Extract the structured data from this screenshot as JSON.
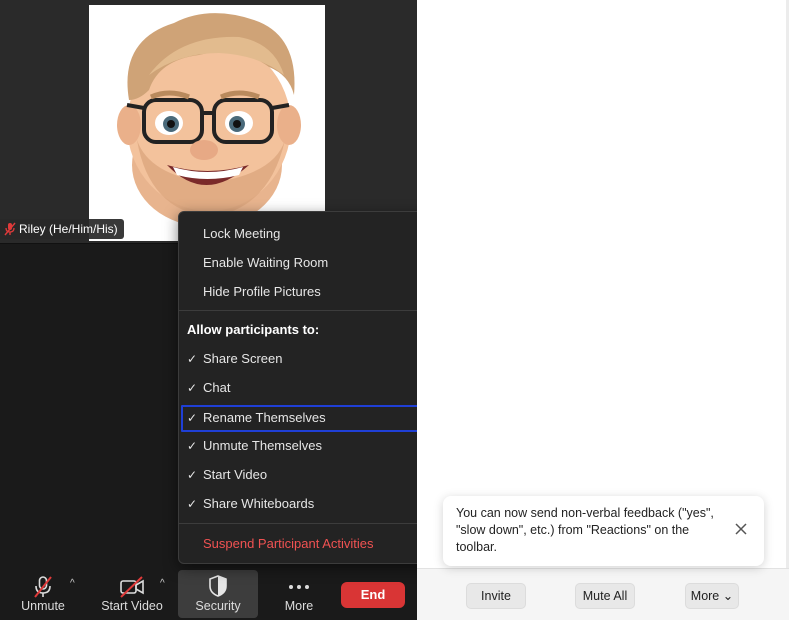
{
  "video": {
    "participant_name": "Riley (He/Him/His)"
  },
  "security_menu": {
    "items_top": [
      {
        "label": "Lock Meeting"
      },
      {
        "label": "Enable Waiting Room"
      },
      {
        "label": "Hide Profile Pictures"
      }
    ],
    "allow_heading": "Allow participants to:",
    "allow_items": [
      {
        "label": "Share Screen",
        "checked": true
      },
      {
        "label": "Chat",
        "checked": true
      },
      {
        "label": "Rename Themselves",
        "checked": true,
        "highlighted": true
      },
      {
        "label": "Unmute Themselves",
        "checked": true
      },
      {
        "label": "Start Video",
        "checked": true
      },
      {
        "label": "Share Whiteboards",
        "checked": true
      }
    ],
    "suspend_label": "Suspend Participant Activities",
    "check_glyph": "✓"
  },
  "toolbar": {
    "unmute_label": "Unmute",
    "start_video_label": "Start Video",
    "security_label": "Security",
    "more_label": "More",
    "end_label": "End",
    "caret_glyph": "^"
  },
  "panel": {
    "invite_label": "Invite",
    "mute_all_label": "Mute All",
    "more_label": "More ⌄"
  },
  "toast": {
    "message": "You can now send non-verbal feedback (\"yes\", \"slow down\", etc.) from \"Reactions\" on the toolbar."
  },
  "colors": {
    "end_button": "#d93535",
    "highlight_border": "#1f3fd6",
    "danger_text": "#f05252",
    "muted_icon": "#e03a3a"
  },
  "icons": {
    "mic": "mic-muted-icon",
    "video": "video-off-icon",
    "security": "shield-icon",
    "more": "ellipsis-icon",
    "close": "close-icon"
  }
}
